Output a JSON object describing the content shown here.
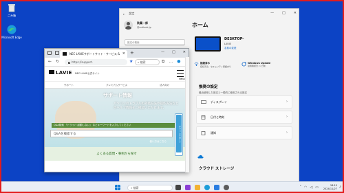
{
  "desktop": {
    "icons": [
      {
        "label": "ごみ箱",
        "icon": "recycle-bin-icon"
      },
      {
        "label": "Microsoft Edge",
        "icon": "edge-icon"
      }
    ]
  },
  "settings": {
    "title": "設定",
    "user_name": "秋葉一郎",
    "user_email": "@outlook.jp",
    "search_placeholder": "設定の検索",
    "home_heading": "ホーム",
    "device_name": "DESKTOP-",
    "device_brand": "LAVIE",
    "rename_link": "名前の変更",
    "network_title": "接続済み",
    "network_sub": "接続済み、セキュリティ保護あり",
    "update_title": "Windows Update",
    "update_sub": "最終確認日: 1 日前",
    "recommended_heading": "推奨の設定",
    "recommended_sub": "最近使用した設定と一般的に使用される設定",
    "rows": [
      "ディスプレイ",
      "日付と時刻",
      "通知"
    ],
    "cloud_heading": "クラウド ストレージ"
  },
  "edge": {
    "tab_title": "NEC LAVIEサポートサイト - サービス &",
    "url": "https://support.",
    "search_placeholder": "検索",
    "site_logo": "LAVIE",
    "site_name": "NEC LAVIE公式サイト",
    "menu_label": "MENU",
    "gnav": [
      "サポート",
      "プレミアムサービス",
      "法人向け"
    ],
    "hero_title": "サポート情報",
    "hero_sub": "パソコンのトラブルの対処方法や操作方法などのヘルプ情報をご確認いただけます。",
    "hero_badge": "Q&A検索 「ドライバ 起動しない」 などキーワードを入力してください",
    "qa_placeholder": "Q&Aを検索する",
    "qa_link": "使い方はこちら",
    "faq_label": "よくある質問・事例から探す",
    "chat_label": "チャットサポート"
  },
  "taskbar": {
    "search_placeholder": "検索",
    "time": "18:15",
    "date": "2024/11/27"
  }
}
